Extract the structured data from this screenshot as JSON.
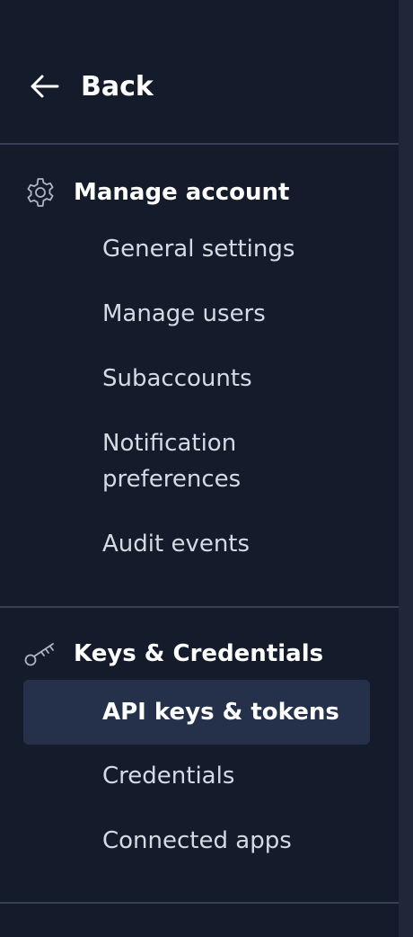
{
  "back": {
    "label": "Back",
    "icon": "arrow-left-icon"
  },
  "sections": [
    {
      "title": "Manage account",
      "icon": "gear-icon",
      "items": [
        {
          "label": "General settings"
        },
        {
          "label": "Manage users"
        },
        {
          "label": "Subaccounts"
        },
        {
          "label": "Notification preferences"
        },
        {
          "label": "Audit events"
        }
      ]
    },
    {
      "title": "Keys & Credentials",
      "icon": "key-icon",
      "items": [
        {
          "label": "API keys & tokens",
          "active": true
        },
        {
          "label": "Credentials"
        },
        {
          "label": "Connected apps"
        }
      ]
    }
  ],
  "colors": {
    "background": "#141c2c",
    "active_background": "#25314a",
    "divider": "#364056",
    "text": "#d5dae3",
    "heading": "#ffffff"
  }
}
